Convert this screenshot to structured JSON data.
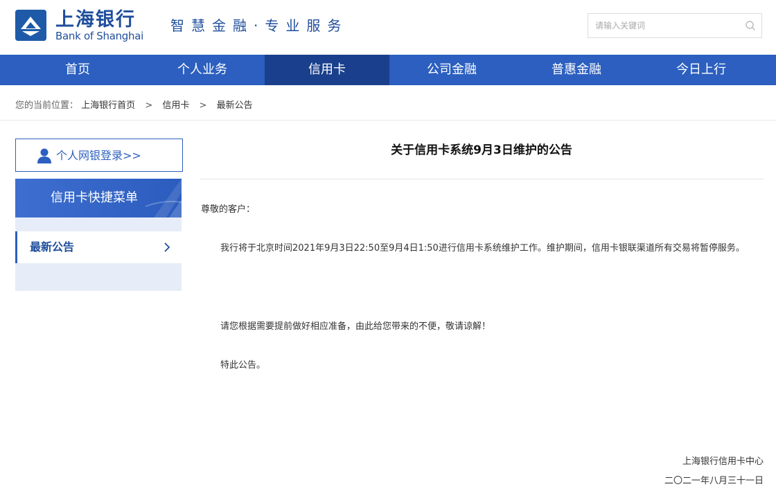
{
  "header": {
    "logo_cn": "上海银行",
    "logo_en": "Bank of Shanghai",
    "slogan": "智慧金融·专业服务",
    "search_placeholder": "请输入关键词"
  },
  "nav": {
    "items": [
      {
        "label": "首页"
      },
      {
        "label": "个人业务"
      },
      {
        "label": "信用卡"
      },
      {
        "label": "公司金融"
      },
      {
        "label": "普惠金融"
      },
      {
        "label": "今日上行"
      }
    ],
    "active_index": 2
  },
  "breadcrumb": {
    "prefix": "您的当前位置：",
    "items": [
      "上海银行首页",
      "信用卡",
      "最新公告"
    ],
    "separator": ">"
  },
  "sidebar": {
    "login_label": "个人网银登录>>",
    "menu_title": "信用卡快捷菜单",
    "menu_items": [
      {
        "label": "最新公告"
      }
    ]
  },
  "article": {
    "title": "关于信用卡系统9月3日维护的公告",
    "greeting": "尊敬的客户：",
    "paragraphs": [
      "我行将于北京时间2021年9月3日22:50至9月4日1:50进行信用卡系统维护工作。维护期间，信用卡银联渠道所有交易将暂停服务。",
      "请您根据需要提前做好相应准备，由此给您带来的不便，敬请谅解！",
      "特此公告。"
    ],
    "signature": "上海银行信用卡中心",
    "date": "二〇二一年八月三十一日"
  },
  "colors": {
    "brand_blue": "#2c5fbf",
    "nav_active": "#1a3f8c",
    "logo_blue": "#1f4e9c",
    "menu_bg": "#e6edf8"
  }
}
